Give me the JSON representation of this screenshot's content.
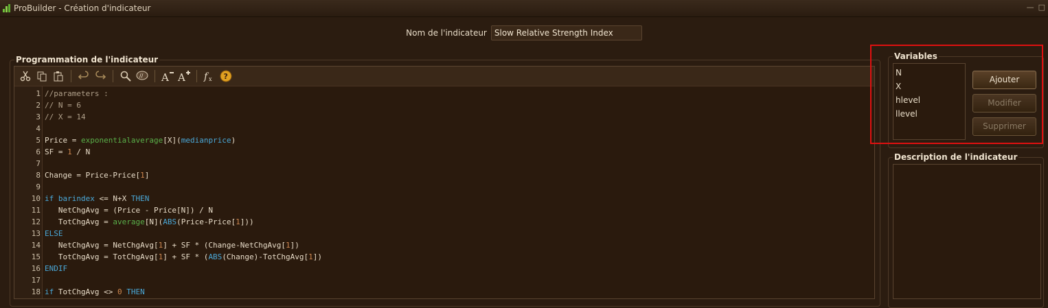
{
  "window": {
    "title": "ProBuilder - Création d'indicateur"
  },
  "header": {
    "name_label": "Nom de l'indicateur",
    "name_value": "Slow Relative Strength Index"
  },
  "editor": {
    "group_title": "Programmation de l'indicateur",
    "toolbar_icons": [
      "cut-icon",
      "copy-icon",
      "paste-icon",
      "undo-icon",
      "redo-icon",
      "search-icon",
      "comment-icon",
      "font-decrease-icon",
      "font-increase-icon",
      "function-icon",
      "help-icon"
    ],
    "lines": [
      {
        "n": "1",
        "html": "<span class=\"cm\">//parameters :</span>"
      },
      {
        "n": "2",
        "html": "<span class=\"cm\">// N = 6</span>"
      },
      {
        "n": "3",
        "html": "<span class=\"cm\">// X = 14</span>"
      },
      {
        "n": "4",
        "html": ""
      },
      {
        "n": "5",
        "html": "Price = <span class=\"fn\">exponentialaverage</span>[X](<span class=\"kw\">medianprice</span>)"
      },
      {
        "n": "6",
        "html": "SF = <span class=\"num\">1</span> / N"
      },
      {
        "n": "7",
        "html": ""
      },
      {
        "n": "8",
        "html": "Change = Price-Price[<span class=\"num\">1</span>]"
      },
      {
        "n": "9",
        "html": ""
      },
      {
        "n": "10",
        "html": "<span class=\"kw\">if</span> <span class=\"kw\">barindex</span> &lt;= N+X <span class=\"kw\">THEN</span>"
      },
      {
        "n": "11",
        "html": "   NetChgAvg = (Price - Price[N]) / N"
      },
      {
        "n": "12",
        "html": "   TotChgAvg = <span class=\"fn\">average</span>[N](<span class=\"kw\">ABS</span>(Price-Price[<span class=\"num\">1</span>]))"
      },
      {
        "n": "13",
        "html": "<span class=\"kw\">ELSE</span>"
      },
      {
        "n": "14",
        "html": "   NetChgAvg = NetChgAvg[<span class=\"num\">1</span>] + SF * (Change-NetChgAvg[<span class=\"num\">1</span>])"
      },
      {
        "n": "15",
        "html": "   TotChgAvg = TotChgAvg[<span class=\"num\">1</span>] + SF * (<span class=\"kw\">ABS</span>(Change)-TotChgAvg[<span class=\"num\">1</span>])"
      },
      {
        "n": "16",
        "html": "<span class=\"kw\">ENDIF</span>"
      },
      {
        "n": "17",
        "html": ""
      },
      {
        "n": "18",
        "html": "<span class=\"kw\">if</span> TotChgAvg &lt;&gt; <span class=\"num\">0</span> <span class=\"kw\">THEN</span>"
      }
    ]
  },
  "variables": {
    "group_title": "Variables",
    "items": [
      "N",
      "X",
      "hlevel",
      "llevel"
    ],
    "buttons": {
      "add": "Ajouter",
      "modify": "Modifier",
      "delete": "Supprimer"
    }
  },
  "description": {
    "group_title": "Description de l'indicateur"
  },
  "colors": {
    "highlight": "#e01010",
    "keyword": "#4aa8d8",
    "function": "#5ab04a",
    "number": "#d08850"
  }
}
